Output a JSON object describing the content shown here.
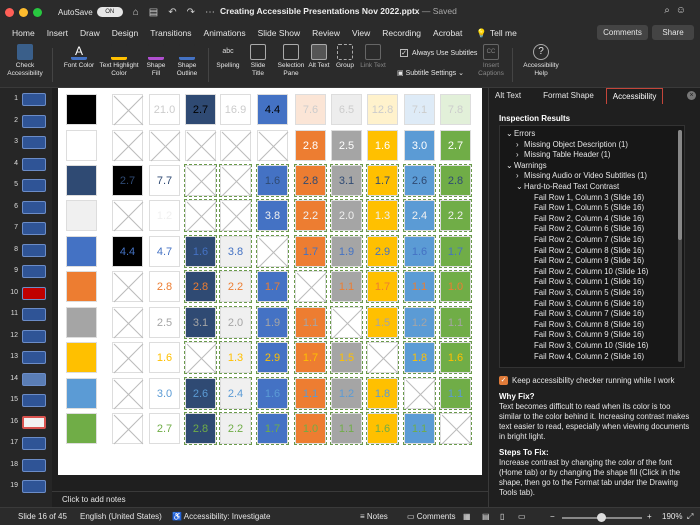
{
  "titlebar": {
    "autosave_label": "AutoSave",
    "toggle_label": "ON",
    "doc_title": "Creating Accessible Presentations Nov 2022.pptx",
    "doc_status": " — Saved"
  },
  "tabs": [
    "Home",
    "Insert",
    "Draw",
    "Design",
    "Transitions",
    "Animations",
    "Slide Show",
    "Review",
    "View",
    "Recording",
    "Acrobat"
  ],
  "active_tab": "Accessibility",
  "tell_me": "Tell me",
  "comments_button": "Comments",
  "share_button": "Share",
  "ribbon": {
    "check_accessibility": "Check Accessibility",
    "font_color": "Font Color",
    "text_highlight": "Text Highlight Color",
    "shape_fill": "Shape Fill",
    "shape_outline": "Shape Outline",
    "spelling": "Spelling",
    "slide_title": "Slide Title",
    "selection_pane": "Selection Pane",
    "alt_text": "Alt Text",
    "group": "Group",
    "link_text": "Link Text",
    "always_subtitles": "Always Use Subtitles",
    "subtitle_settings": "Subtitle Settings",
    "insert_captions": "Insert Captions",
    "accessibility_help": "Accessibility Help"
  },
  "thumbnails": [
    "1",
    "2",
    "3",
    "4",
    "5",
    "6",
    "7",
    "8",
    "9",
    "10",
    "11",
    "12",
    "13",
    "14",
    "15",
    "16",
    "17",
    "18",
    "19"
  ],
  "selected_thumbnail": "16",
  "slide": {
    "col1_colors": [
      "#000000",
      "#ffffff",
      "#2f4a73",
      "#f0f0f0",
      "#4472c4",
      "#ed7d31",
      "#a5a5a5",
      "#ffc000",
      "#5b9bd5",
      "#70ad47"
    ],
    "rows": [
      {
        "c2": "",
        "c3": "21.0",
        "c4": "2.7",
        "c5": "16.9",
        "c6": "4.4",
        "c7": "7.6",
        "c8": "6.5",
        "c9": "12.8",
        "c10": "7.1",
        "c11": "7.8"
      },
      {
        "c2": "",
        "c3": "",
        "c4": "",
        "c5": "",
        "c6": "",
        "c7": "2.8",
        "c8": "2.5",
        "c9": "1.6",
        "c10": "3.0",
        "c11": "2.7"
      },
      {
        "c2": "2.7",
        "c3": "7.7",
        "c4": "",
        "c5": "",
        "c6": "1.6",
        "c7": "2.8",
        "c8": "3.1",
        "c9": "1.7",
        "c10": "2.6",
        "c11": "2.8"
      },
      {
        "c2": "",
        "c3": "1.2",
        "c4": "",
        "c5": "",
        "c6": "3.8",
        "c7": "2.2",
        "c8": "2.0",
        "c9": "1.3",
        "c10": "2.4",
        "c11": "2.2"
      },
      {
        "c2": "4.4",
        "c3": "4.7",
        "c4": "1.6",
        "c5": "3.8",
        "c6": "",
        "c7": "1.7",
        "c8": "1.9",
        "c9": "2.9",
        "c10": "1.6",
        "c11": "1.7"
      },
      {
        "c2": "",
        "c3": "2.8",
        "c4": "2.8",
        "c5": "2.2",
        "c6": "1.7",
        "c7": "",
        "c8": "1.1",
        "c9": "1.7",
        "c10": "1.1",
        "c11": "1.0"
      },
      {
        "c2": "",
        "c3": "2.5",
        "c4": "3.1",
        "c5": "2.0",
        "c6": "1.9",
        "c7": "1.1",
        "c8": "",
        "c9": "1.5",
        "c10": "1.2",
        "c11": "1.1"
      },
      {
        "c2": "",
        "c3": "1.6",
        "c4": "",
        "c5": "1.3",
        "c6": "2.9",
        "c7": "1.7",
        "c8": "1.5",
        "c9": "",
        "c10": "1.8",
        "c11": "1.6"
      },
      {
        "c2": "",
        "c3": "3.0",
        "c4": "2.6",
        "c5": "2.4",
        "c6": "1.6",
        "c7": "1.1",
        "c8": "1.2",
        "c9": "1.8",
        "c10": "",
        "c11": "1.1"
      },
      {
        "c2": "",
        "c3": "2.7",
        "c4": "2.8",
        "c5": "2.2",
        "c6": "1.7",
        "c7": "1.0",
        "c8": "1.1",
        "c9": "1.6",
        "c10": "1.1",
        "c11": ""
      }
    ]
  },
  "notes_placeholder": "Click to add notes",
  "pane": {
    "tabs": [
      "Alt Text",
      "Format Shape",
      "Accessibility"
    ],
    "inspection_results": "Inspection Results",
    "tree": [
      {
        "indent": 0,
        "arrow": "⌄",
        "text": "Errors"
      },
      {
        "indent": 1,
        "arrow": "›",
        "text": "Missing Object Description (1)"
      },
      {
        "indent": 1,
        "arrow": "›",
        "text": "Missing Table Header (1)"
      },
      {
        "indent": 0,
        "arrow": "⌄",
        "text": "Warnings"
      },
      {
        "indent": 1,
        "arrow": "›",
        "text": "Missing Audio or Video Subtitles (1)"
      },
      {
        "indent": 1,
        "arrow": "⌄",
        "text": "Hard-to-Read Text Contrast"
      },
      {
        "indent": 2,
        "arrow": "",
        "text": "Fail Row 1, Column 3  (Slide 16)"
      },
      {
        "indent": 2,
        "arrow": "",
        "text": "Fail Row 1, Column 5  (Slide 16)"
      },
      {
        "indent": 2,
        "arrow": "",
        "text": "Fail Row 2, Column 4  (Slide 16)"
      },
      {
        "indent": 2,
        "arrow": "",
        "text": "Fail Row 2, Column 6  (Slide 16)"
      },
      {
        "indent": 2,
        "arrow": "",
        "text": "Fail Row 2, Column 7  (Slide 16)"
      },
      {
        "indent": 2,
        "arrow": "",
        "text": "Fail Row 2, Column 8  (Slide 16)"
      },
      {
        "indent": 2,
        "arrow": "",
        "text": "Fail Row 2, Column 9  (Slide 16)"
      },
      {
        "indent": 2,
        "arrow": "",
        "text": "Fail Row 2, Column 10  (Slide 16)"
      },
      {
        "indent": 2,
        "arrow": "",
        "text": "Fail Row 3, Column 1  (Slide 16)"
      },
      {
        "indent": 2,
        "arrow": "",
        "text": "Fail Row 3, Column 5  (Slide 16)"
      },
      {
        "indent": 2,
        "arrow": "",
        "text": "Fail Row 3, Column 6  (Slide 16)"
      },
      {
        "indent": 2,
        "arrow": "",
        "text": "Fail Row 3, Column 7  (Slide 16)"
      },
      {
        "indent": 2,
        "arrow": "",
        "text": "Fail Row 3, Column 8  (Slide 16)"
      },
      {
        "indent": 2,
        "arrow": "",
        "text": "Fail Row 3, Column 9  (Slide 16)"
      },
      {
        "indent": 2,
        "arrow": "",
        "text": "Fail Row 3, Column 10  (Slide 16)"
      },
      {
        "indent": 2,
        "arrow": "",
        "text": "Fail Row 4, Column 2  (Slide 16)"
      }
    ],
    "keep_running": "Keep accessibility checker running while I work",
    "why_fix_title": "Why Fix?",
    "why_fix_text": "Text becomes difficult to read when its color is too similar to the color behind it. Increasing contrast makes text easier to read, especially when viewing documents in bright light.",
    "steps_title": "Steps To Fix:",
    "steps_text": "Increase contrast by changing the color of the font (Home tab) or by changing the shape fill (Click in the shape, then go to the Format tab under the Drawing Tools tab)."
  },
  "status": {
    "slide_of": "Slide 16 of 45",
    "language": "English (United States)",
    "accessibility": "Accessibility: Investigate",
    "notes": "Notes",
    "comments": "Comments",
    "zoom": "190%"
  },
  "colors": {
    "accent": "#c4453a",
    "orange": "#ed7d31",
    "gray": "#a5a5a5",
    "gold": "#ffc000",
    "blue": "#4472c4",
    "lightblue": "#5b9bd5",
    "green": "#70ad47",
    "navy": "#2f4a73"
  }
}
